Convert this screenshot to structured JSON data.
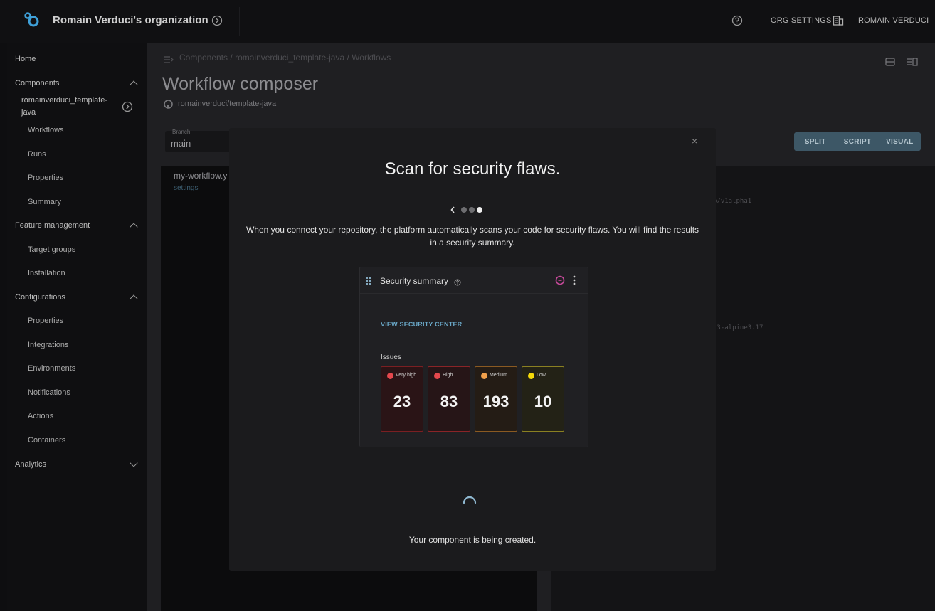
{
  "header": {
    "org_title": "Romain Verduci's organization",
    "org_settings_label": "ORG SETTINGS",
    "user_name": "ROMAIN VERDUCI",
    "icons": [
      "logo-icon",
      "org-switch-icon",
      "help-icon",
      "building-icon"
    ]
  },
  "sidebar": {
    "home": "Home",
    "components": "Components",
    "component_name_line1": "romainverduci_template-",
    "component_name_line2": "java",
    "component_items": [
      "Workflows",
      "Runs",
      "Properties",
      "Summary"
    ],
    "feature_management": "Feature management",
    "feature_items": [
      "Target groups",
      "Installation"
    ],
    "configurations": "Configurations",
    "configuration_items": [
      "Properties",
      "Integrations",
      "Environments",
      "Notifications",
      "Actions",
      "Containers"
    ],
    "analytics": "Analytics"
  },
  "page": {
    "breadcrumb": [
      "Components",
      "/",
      "romainverduci_template-java",
      "/",
      "Workflows"
    ],
    "title": "Workflow composer",
    "repo": "romainverduci/template-java",
    "branch_label": "Branch",
    "branch_value": "main",
    "view_modes": [
      "SPLIT",
      "SCRIPT",
      "VISUAL"
    ],
    "filename": "my-workflow.y",
    "file_settings": "settings",
    "code_line_1": "o/v1alpha1",
    "code_line_2": ".3-alpine3.17"
  },
  "modal": {
    "close": "×",
    "title": "Scan for security flaws.",
    "text": "When you connect your repository, the platform automatically scans your code for security flaws. You will find the results in a security summary.",
    "pager_step": 3,
    "pager_total": 3,
    "card": {
      "title": "Security summary",
      "view_link": "VIEW SECURITY CENTER",
      "issues_label": "Issues",
      "issues": [
        {
          "label": "Very high",
          "count": "23",
          "color": "#e5484d"
        },
        {
          "label": "High",
          "count": "83",
          "color": "#e5484d"
        },
        {
          "label": "Medium",
          "count": "193",
          "color": "#f0a04b"
        },
        {
          "label": "Low",
          "count": "10",
          "color": "#f5d90a"
        }
      ]
    },
    "status": "Your component is being created."
  },
  "colors": {
    "accent": "#6aa8c8",
    "segment_bg": "#3d5766"
  }
}
